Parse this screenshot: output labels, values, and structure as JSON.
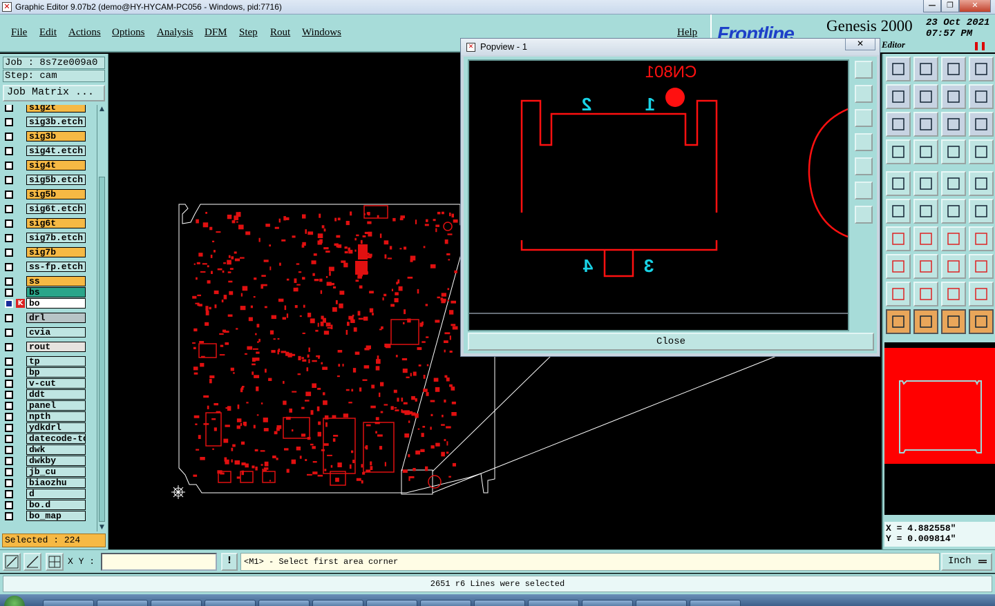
{
  "window": {
    "title": "Graphic Editor 9.07b2 (demo@HY-HYCAM-PC056 - Windows, pid:7716)",
    "min_glyph": "—",
    "max_glyph": "❐",
    "close_glyph": "✕"
  },
  "menu": {
    "items": [
      "File",
      "Edit",
      "Actions",
      "Options",
      "Analysis",
      "DFM",
      "Step",
      "Rout",
      "Windows"
    ],
    "help": "Help"
  },
  "logo": {
    "brand": "Frontline",
    "product": "Genesis 2000",
    "date": "23 Oct 2021",
    "time": "07:57 PM",
    "module": "Editor",
    "pause_glyph": "❚❚"
  },
  "left": {
    "job": "Job : 8s7ze009a0",
    "step": "Step: cam",
    "job_matrix": "Job Matrix ...",
    "selected": "Selected : 224",
    "scroll_up": "▲",
    "scroll_down": "▼"
  },
  "layers": [
    {
      "name": "sig2t",
      "color": "#f6b944"
    },
    {
      "name": "sig3b.etch",
      "color": "#bfe5e2"
    },
    {
      "name": "sig3b",
      "color": "#f6b944"
    },
    {
      "name": "sig4t.etch",
      "color": "#bfe5e2"
    },
    {
      "name": "sig4t",
      "color": "#f6b944"
    },
    {
      "name": "sig5b.etch",
      "color": "#bfe5e2"
    },
    {
      "name": "sig5b",
      "color": "#f6b944"
    },
    {
      "name": "sig6t.etch",
      "color": "#bfe5e2"
    },
    {
      "name": "sig6t",
      "color": "#f6b944"
    },
    {
      "name": "sig7b.etch",
      "color": "#bfe5e2"
    },
    {
      "name": "sig7b",
      "color": "#f6b944"
    },
    {
      "name": "ss-fp.etch",
      "color": "#bfe5e2"
    },
    {
      "name": "ss",
      "color": "#f6b944"
    },
    {
      "name": "bs",
      "color": "#2aa58a"
    },
    {
      "name": "bo",
      "color": "#ffffff",
      "active": true
    },
    {
      "name": "drl",
      "color": "#b7c4c6"
    },
    {
      "name": "cvia",
      "color": "#bfe5e2"
    },
    {
      "name": "rout",
      "color": "#e6e3df"
    },
    {
      "name": "tp",
      "color": "#bfe5e2"
    },
    {
      "name": "bp",
      "color": "#bfe5e2"
    },
    {
      "name": "v-cut",
      "color": "#bfe5e2"
    },
    {
      "name": "ddt",
      "color": "#bfe5e2"
    },
    {
      "name": "panel",
      "color": "#bfe5e2"
    },
    {
      "name": "npth",
      "color": "#bfe5e2"
    },
    {
      "name": "ydkdrl",
      "color": "#bfe5e2"
    },
    {
      "name": "datecode-to",
      "color": "#bfe5e2"
    },
    {
      "name": "dwk",
      "color": "#bfe5e2"
    },
    {
      "name": "dwkby",
      "color": "#bfe5e2"
    },
    {
      "name": "jb_cu",
      "color": "#bfe5e2"
    },
    {
      "name": "biaozhu",
      "color": "#bfe5e2"
    },
    {
      "name": "d",
      "color": "#bfe5e2"
    },
    {
      "name": "bo.d",
      "color": "#bfe5e2"
    },
    {
      "name": "bo_map",
      "color": "#bfe5e2"
    }
  ],
  "popview": {
    "title": "Popview - 1",
    "close_glyph": "✕",
    "close_label": "Close",
    "refdes": "CN801",
    "pins": [
      "2",
      "1",
      "4",
      "3"
    ]
  },
  "coords": {
    "x": "X = 4.882558\"",
    "y": "Y = 0.009814\""
  },
  "command": {
    "xy_label": "X Y :",
    "xy_value": "",
    "excl": "!",
    "prompt": "<M1> - Select first area corner",
    "unit": "Inch"
  },
  "status": "2651 r6 Lines were selected",
  "colors": {
    "panel_bg": "#a7dcd9",
    "feature_red": "#ff0000",
    "pin_cyan": "#19d3e6",
    "selected_orange": "#f6b944"
  }
}
